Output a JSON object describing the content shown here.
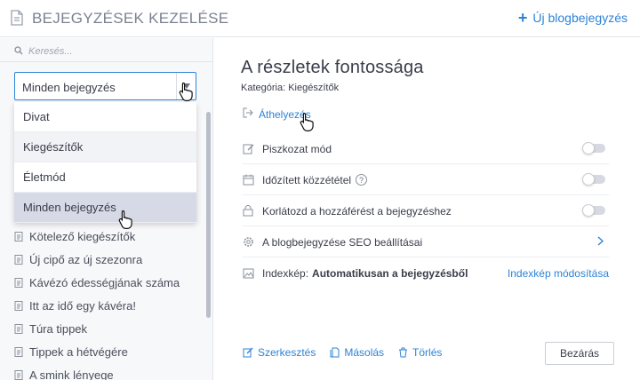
{
  "header": {
    "title": "BEJEGYZÉSEK KEZELÉSE",
    "new_post": "Új blogbejegyzés"
  },
  "sidebar": {
    "search_placeholder": "Keresés...",
    "filter": {
      "value": "Minden bejegyzés",
      "options": [
        "Divat",
        "Kiegészítők",
        "Életmód",
        "Minden bejegyzés"
      ]
    },
    "posts": [
      "Kötelező kiegészítők",
      "Új cipő az új szezonra",
      "Kávézó édességjának száma",
      "Itt az idő egy kávéra!",
      "Túra tippek",
      "Tippek a hétvégére",
      "A smink lényege"
    ]
  },
  "main": {
    "title": "A részletek fontossága",
    "category": "Kategória: Kiegészítők",
    "move": "Áthelyezés",
    "rows": {
      "draft": "Piszkozat mód",
      "scheduled": "Időzített közzététel",
      "restrict": "Korlátozd a hozzáférést a bejegyzéshez",
      "seo": "A blogbejegyzése SEO beállításai",
      "cover_label": "Indexkép:",
      "cover_value": "Automatikusan a bejegyzésből",
      "cover_change": "Indexkép módosítása"
    },
    "toggles": {
      "draft": false,
      "scheduled": false,
      "restrict": false
    },
    "actions": {
      "edit": "Szerkesztés",
      "copy": "Másolás",
      "delete": "Törlés",
      "close": "Bezárás"
    }
  },
  "colors": {
    "accent": "#2d83d6",
    "text": "#3a3d4a",
    "muted": "#7a8190"
  }
}
